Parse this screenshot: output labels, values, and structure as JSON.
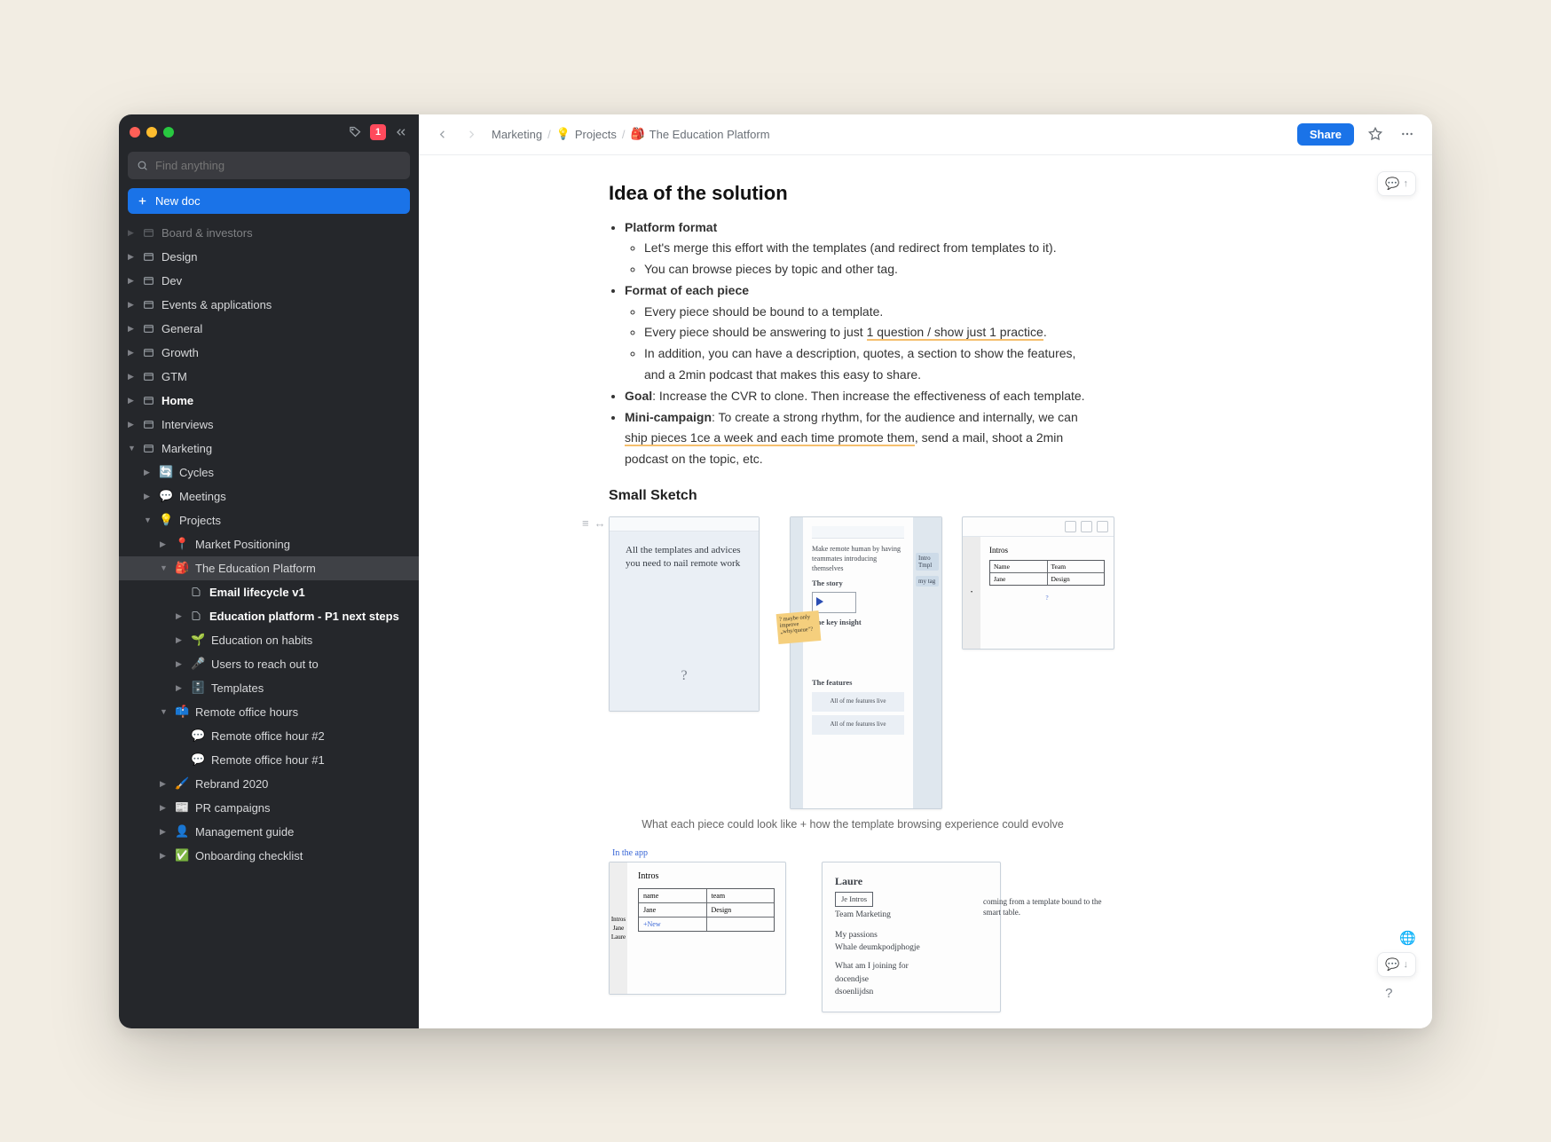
{
  "notif_count": "1",
  "search_placeholder": "Find anything",
  "new_doc": "New doc",
  "sidebar_items": {
    "board": "Board & investors",
    "design": "Design",
    "dev": "Dev",
    "events": "Events & applications",
    "general": "General",
    "growth": "Growth",
    "gtm": "GTM",
    "home": "Home",
    "interviews": "Interviews",
    "marketing": "Marketing",
    "cycles": "Cycles",
    "meetings": "Meetings",
    "projects": "Projects",
    "market_pos": "Market Positioning",
    "edu_platform": "The Education Platform",
    "email_lc": "Email lifecycle v1",
    "edu_p1": "Education platform - P1 next steps",
    "edu_habits": "Education on habits",
    "users_reach": "Users to reach out to",
    "templates": "Templates",
    "office_hours": "Remote office hours",
    "office_h2": "Remote office hour #2",
    "office_h1": "Remote office hour #1",
    "rebrand": "Rebrand 2020",
    "pr": "PR campaigns",
    "mgmt": "Management guide",
    "onboard": "Onboarding checklist"
  },
  "breadcrumb": {
    "a": "Marketing",
    "b": "Projects",
    "c": "The Education Platform"
  },
  "share": "Share",
  "doc": {
    "h_idea": "Idea of the solution",
    "platform_format": "Platform format",
    "pf1": "Let's merge this effort with the templates (and redirect from templates to it).",
    "pf2": "You can browse pieces by topic and other tag.",
    "fep": "Format of each piece",
    "fep1": "Every piece should be bound to a template.",
    "fep2a": "Every piece should be answering to just ",
    "fep2b": "1 question / show just 1 practice",
    "fep2c": ".",
    "fep3": "In addition, you can have a description, quotes, a section to show the features, and a 2min podcast that makes this easy to share.",
    "goal_b": "Goal",
    "goal_t": ": Increase the CVR to clone. Then increase the effectiveness of each template.",
    "mc_b": "Mini-campaign",
    "mc_t1": ": To create a strong rhythm, for the audience and internally, we can ",
    "mc_u": "ship pieces 1ce a week and each time promote them",
    "mc_t2": ", send a mail, shoot a 2min podcast on the topic, etc.",
    "h_sketch": "Small Sketch",
    "sketch_caption": "What each piece could look like + how the template browsing experience could evolve",
    "in_app": "In the app"
  },
  "sketch": {
    "m1_text": "All the templates and advices you need to nail remote work",
    "m1_q": "?",
    "sticky": "? maybe only improve „why/queue\"?",
    "m2_title": "Make remote human by having teammates introducing themselves",
    "m2_story": "The story",
    "m2_insight": "The key insight",
    "m2_features": "The features",
    "m2_feat": "All of me features live",
    "m2_tag1": "Intro Tmpl",
    "m2_tag2": "my tag",
    "m3_h": "Intros",
    "m3_c1": "Name",
    "m3_c2": "Team",
    "m3_r1a": "Jane",
    "m3_r1b": "Design",
    "m3_below": "?",
    "m4_h": "Intros",
    "m4_c1": "name",
    "m4_c2": "team",
    "m4_r1a": "Jane",
    "m4_r1b": "Design",
    "m4_side1": "Intros",
    "m4_side2": "Jane",
    "m4_side3": "Laure",
    "m5_name": "Laure",
    "m5_p1": "Je Intros",
    "m5_p2": "Team Marketing",
    "m5_l1": "My passions",
    "m5_l2": "Whale deumkpodjphogje",
    "m5_l3": "What am I joining for",
    "m5_l4": "docendjse",
    "m5_l5": "dsoenlijdsn",
    "arrow_note": "coming from a template bound to the smart table."
  }
}
